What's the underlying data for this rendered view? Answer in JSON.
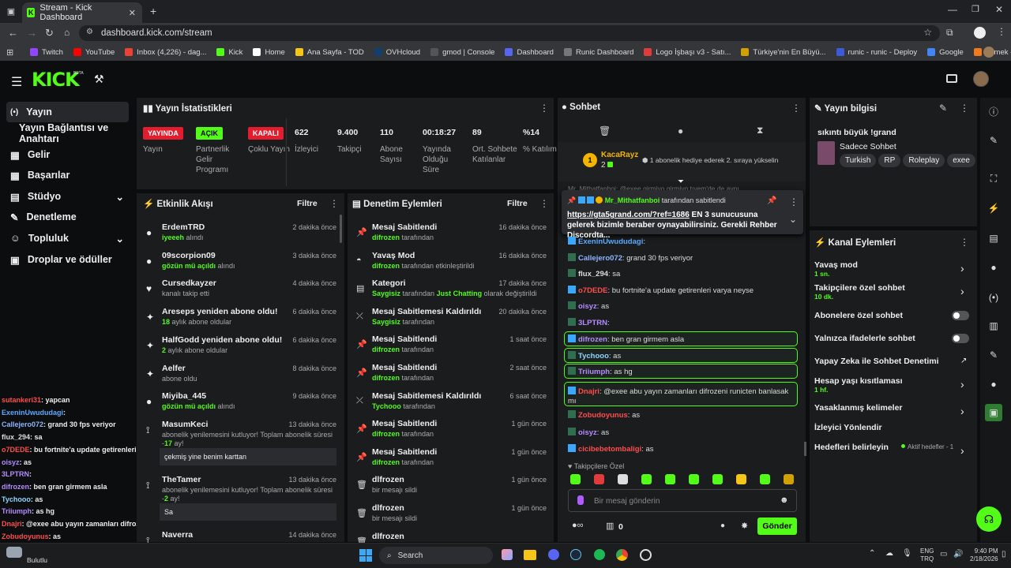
{
  "browser": {
    "tab_title": "Stream - Kick Dashboard",
    "url": "dashboard.kick.com/stream",
    "bookmarks": [
      {
        "label": "Twitch",
        "color": "#9146ff"
      },
      {
        "label": "YouTube",
        "color": "#ff0000"
      },
      {
        "label": "Inbox (4,226) - dag...",
        "color": "#ea4335"
      },
      {
        "label": "Kick",
        "color": "#53fc18"
      },
      {
        "label": "Home",
        "color": "#ffffff"
      },
      {
        "label": "Ana Sayfa - TOD",
        "color": "#f5c518"
      },
      {
        "label": "OVHcloud",
        "color": "#123f6d"
      },
      {
        "label": "gmod | Console",
        "color": "#555555"
      },
      {
        "label": "Dashboard",
        "color": "#5865f2"
      },
      {
        "label": "Runic Dashboard",
        "color": "#777777"
      },
      {
        "label": "Logo İşbaşı v3 - Satı...",
        "color": "#e23b3b"
      },
      {
        "label": "Türkiye'nin En Büyü...",
        "color": "#d2a000"
      },
      {
        "label": "runic - runic - Deploy",
        "color": "#3b5bdb"
      },
      {
        "label": "Google",
        "color": "#4285f4"
      },
      {
        "label": "Yemek - Trendyol Go",
        "color": "#f27a1a"
      }
    ]
  },
  "sidebar": {
    "items": [
      {
        "label": "Yayın",
        "icon": "broadcast-icon"
      },
      {
        "label": "Yayın Bağlantısı ve Anahtarı"
      },
      {
        "label": "Gelir",
        "icon": "revenue-icon"
      },
      {
        "label": "Başarılar",
        "icon": "achievements-icon"
      },
      {
        "label": "Stüdyo",
        "icon": "studio-icon"
      },
      {
        "label": "Denetleme",
        "icon": "wrench-icon"
      },
      {
        "label": "Topluluk",
        "icon": "community-icon"
      },
      {
        "label": "Droplar ve ödüller",
        "icon": "gift-icon"
      }
    ]
  },
  "stats": {
    "title": "Yayın İstatistikleri",
    "badges": [
      {
        "text": "YAYINDA",
        "label": "Yayın",
        "color": "#e11d2e"
      },
      {
        "text": "AÇIK",
        "label": "Partnerlik Gelir Programı",
        "color": "#53fc18"
      },
      {
        "text": "KAPALI",
        "label": "Çoklu Yayın",
        "color": "#e11d2e"
      }
    ],
    "values": [
      {
        "value": "622",
        "label": "İzleyici"
      },
      {
        "value": "9.400",
        "label": "Takipçi"
      },
      {
        "value": "110",
        "label": "Abone Sayısı"
      },
      {
        "value": "00:18:27",
        "label": "Yayında Olduğu Süre"
      },
      {
        "value": "89",
        "label": "Ort. Sohbete Katılanlar"
      },
      {
        "value": "%14",
        "label": "% Katılım"
      }
    ]
  },
  "activity": {
    "title": "Etkinlik Akışı",
    "filter": "Filtre",
    "items": [
      {
        "name": "ErdemTRD",
        "sub_green": "iyeeeh",
        "sub": " alındı",
        "time": "2 dakika önce"
      },
      {
        "name": "09scorpion09",
        "sub_green": "gözün mü açıldı",
        "sub": " alındı",
        "time": "3 dakika önce"
      },
      {
        "name": "Cursedkayzer",
        "sub_green": "",
        "sub": "kanalı takip etti",
        "time": "4 dakika önce"
      },
      {
        "name": "Areseps yeniden abone oldu!",
        "sub_green": "18",
        "sub": " aylık abone oldular",
        "time": "6 dakika önce"
      },
      {
        "name": "HalfGodd yeniden abone oldu!",
        "sub_green": "2",
        "sub": " aylık abone oldular",
        "time": "6 dakika önce"
      },
      {
        "name": "Aelfer",
        "sub_green": "",
        "sub": "abone oldu",
        "time": "8 dakika önce"
      },
      {
        "name": "Miyiba_445",
        "sub_green": "gözün mü açıldı",
        "sub": " alındı",
        "time": "9 dakika önce"
      },
      {
        "name": "MasumKeci",
        "sub_green": "",
        "sub": "abonelik yenilemesini kutluyor! Toplam abonelik süresi -",
        "extra_green": "17",
        "extra": " ay!",
        "message": "çekmiş yine benim karttan",
        "time": "13 dakika önce"
      },
      {
        "name": "TheTamer",
        "sub_green": "",
        "sub": "abonelik yenilemesini kutluyor! Toplam abonelik süresi -",
        "extra_green": "2",
        "extra": " ay!",
        "message": "Sa",
        "time": "13 dakika önce"
      },
      {
        "name": "Naverra",
        "sub_green": "",
        "sub": "",
        "time": "14 dakika önce"
      }
    ]
  },
  "moderation": {
    "title": "Denetim Eylemleri",
    "filter": "Filtre",
    "items": [
      {
        "title": "Mesaj Sabitlendi",
        "user": "difrozen",
        "sub": " tarafından",
        "time": "16 dakika önce",
        "icon": "pin-icon"
      },
      {
        "title": "Yavaş Mod",
        "user": "difrozen",
        "sub": " tarafından etkinleştirildi",
        "time": "16 dakika önce",
        "icon": "slow-mode-icon"
      },
      {
        "title": "Kategori",
        "user": "Saygisiz",
        "sub": " tarafından ",
        "sub2_green": "Just Chatting",
        "sub2": " olarak değiştirildi",
        "time": "17 dakika önce",
        "icon": "category-icon"
      },
      {
        "title": "Mesaj Sabitlemesi Kaldırıldı",
        "user": "Saygisiz",
        "sub": " tarafından",
        "time": "20 dakika önce",
        "icon": "unpin-icon"
      },
      {
        "title": "Mesaj Sabitlendi",
        "user": "difrozen",
        "sub": " tarafından",
        "time": "1 saat önce",
        "icon": "pin-icon"
      },
      {
        "title": "Mesaj Sabitlendi",
        "user": "difrozen",
        "sub": " tarafından",
        "time": "2 saat önce",
        "icon": "pin-icon"
      },
      {
        "title": "Mesaj Sabitlemesi Kaldırıldı",
        "user": "Tychooo",
        "sub": " tarafından",
        "time": "6 saat önce",
        "icon": "unpin-icon"
      },
      {
        "title": "Mesaj Sabitlendi",
        "user": "difrozen",
        "sub": " tarafından",
        "time": "1 gün önce",
        "icon": "pin-icon"
      },
      {
        "title": "Mesaj Sabitlendi",
        "user": "difrozen",
        "sub": " tarafından",
        "time": "1 gün önce",
        "icon": "pin-icon"
      },
      {
        "title": "dlfrozen",
        "user": "",
        "sub": "bir mesajı sildi",
        "time": "1 gün önce",
        "icon": "trash-icon"
      },
      {
        "title": "dlfrozen",
        "user": "",
        "sub": "bir mesajı sildi",
        "time": "1 gün önce",
        "icon": "trash-icon"
      },
      {
        "title": "dlfrozen",
        "user": "",
        "sub": "",
        "time": "",
        "icon": "trash-icon"
      }
    ]
  },
  "chat": {
    "title": "Sohbet",
    "gifter": {
      "name": "KacaRayz",
      "rank": "1",
      "count": "2",
      "text": "1 abonelik hediye ederek 2. sıraya yükselin"
    },
    "top_hidden": "Mr_Mithatfanboi: @exee girmiyo girmiyo tıyem'de de aynı",
    "pinned": {
      "by": "Mr_Mithatfanboi",
      "by_sub": " tarafından sabitlendi",
      "link": "https://gta5grand.com/?ref=1686",
      "text": " EN 3 sunucusuna gelerek bizimle beraber oynayabilirsiniz. Gerekli Rehber Discordta..."
    },
    "messages": [
      {
        "user": "ExeninUwududagi",
        "text": ":",
        "color": "#5aa9ff"
      },
      {
        "user": "Callejero072",
        "text": ": grand 30 fps veriyor",
        "color": "#8fb4ff"
      },
      {
        "user": "flux_294",
        "text": ": sa",
        "color": "#ddd"
      },
      {
        "user": "o7DEDE",
        "text": ": bu fortnite'a update getirenleri varya neyse",
        "color": "#ff4d4d"
      },
      {
        "user": "oisyz",
        "text": ": as",
        "color": "#b48cff"
      },
      {
        "user": "3LPTRN",
        "text": ":",
        "color": "#b48cff"
      },
      {
        "user": "difrozen",
        "text": ": ben gran girmem asla",
        "color": "#b48cff"
      },
      {
        "user": "Tychooo",
        "text": ": as",
        "color": "#8fd6ff"
      },
      {
        "user": "Triiumph",
        "text": ": as hg",
        "color": "#b48cff"
      },
      {
        "user": "Dnajri",
        "text": ": @exee abu yayın zamanları difrozeni runicten banlasak mı",
        "color": "#ff4d4d"
      },
      {
        "user": "Zobudoyunus",
        "text": ": as",
        "color": "#ff4d4d"
      },
      {
        "user": "oisyz",
        "text": ": as",
        "color": "#b48cff"
      },
      {
        "user": "cicibebetombaligi",
        "text": ": as",
        "color": "#ff4d4d"
      }
    ],
    "followers_only": "Takipçilere Özel",
    "placeholder": "Bir mesaj gönderin",
    "points": "0",
    "send": "Gönder"
  },
  "stream_info": {
    "title": "Yayın bilgisi",
    "stream_title": "sıkıntı büyük !grand",
    "category": "Sadece Sohbet",
    "tags": [
      "Turkish",
      "RP",
      "Roleplay",
      "exee"
    ]
  },
  "channel_actions": {
    "title": "Kanal Eylemleri",
    "items": [
      {
        "label": "Yavaş mod",
        "sub": "1 sn.",
        "control": "chevron"
      },
      {
        "label": "Takipçilere özel sohbet",
        "sub": "10 dk.",
        "control": "chevron"
      },
      {
        "label": "Abonelere özel sohbet",
        "sub": "",
        "control": "toggle"
      },
      {
        "label": "Yalnızca ifadelerle sohbet",
        "sub": "",
        "control": "toggle"
      },
      {
        "label": "Yapay Zeka ile Sohbet Denetimi",
        "sub": "",
        "control": "external"
      },
      {
        "label": "Hesap yaşı kısıtlaması",
        "sub": "1 hf.",
        "control": "chevron"
      },
      {
        "label": "Yasaklanmış kelimeler",
        "sub": "",
        "control": "chevron"
      },
      {
        "label": "İzleyici Yönlendir",
        "sub": "",
        "control": "none"
      },
      {
        "label": "Hedefleri belirleyin",
        "sub": "",
        "status": "Aktif hedefler - 1",
        "control": "chevron"
      }
    ]
  },
  "overlay_chat": [
    {
      "user": "sutankeri31",
      "text": ": yapcan",
      "color": "#ff4d4d"
    },
    {
      "user": "ExeninUwududagi",
      "text": ":",
      "color": "#5aa9ff"
    },
    {
      "user": "Callejero072",
      "text": ": grand 30 fps veriyor",
      "color": "#8fb4ff"
    },
    {
      "user": "flux_294",
      "text": ": sa",
      "color": "#ddd"
    },
    {
      "user": "o7DEDE",
      "text": ": bu fortnite'a update getirenleri varya neyse",
      "color": "#ff4d4d"
    },
    {
      "user": "oisyz",
      "text": ": as",
      "color": "#b48cff"
    },
    {
      "user": "3LPTRN",
      "text": ":",
      "color": "#b48cff"
    },
    {
      "user": "difrozen",
      "text": ": ben gran girmem asla",
      "color": "#b48cff"
    },
    {
      "user": "Tychooo",
      "text": ": as",
      "color": "#8fd6ff"
    },
    {
      "user": "Triiumph",
      "text": ": as hg",
      "color": "#b48cff"
    },
    {
      "user": "Dnajri",
      "text": ": @exee abu yayın zamanları difrozeni runicten banlasak mı",
      "color": "#ff4d4d"
    },
    {
      "user": "Zobudoyunus",
      "text": ": as",
      "color": "#ff4d4d"
    },
    {
      "user": "oisyz",
      "text": ": as",
      "color": "#b48cff"
    }
  ],
  "taskbar": {
    "weather": "Bulutlu",
    "search": "Search",
    "lang1": "ENG",
    "lang2": "TRQ",
    "time": "9:40 PM",
    "date": "2/18/2026"
  }
}
